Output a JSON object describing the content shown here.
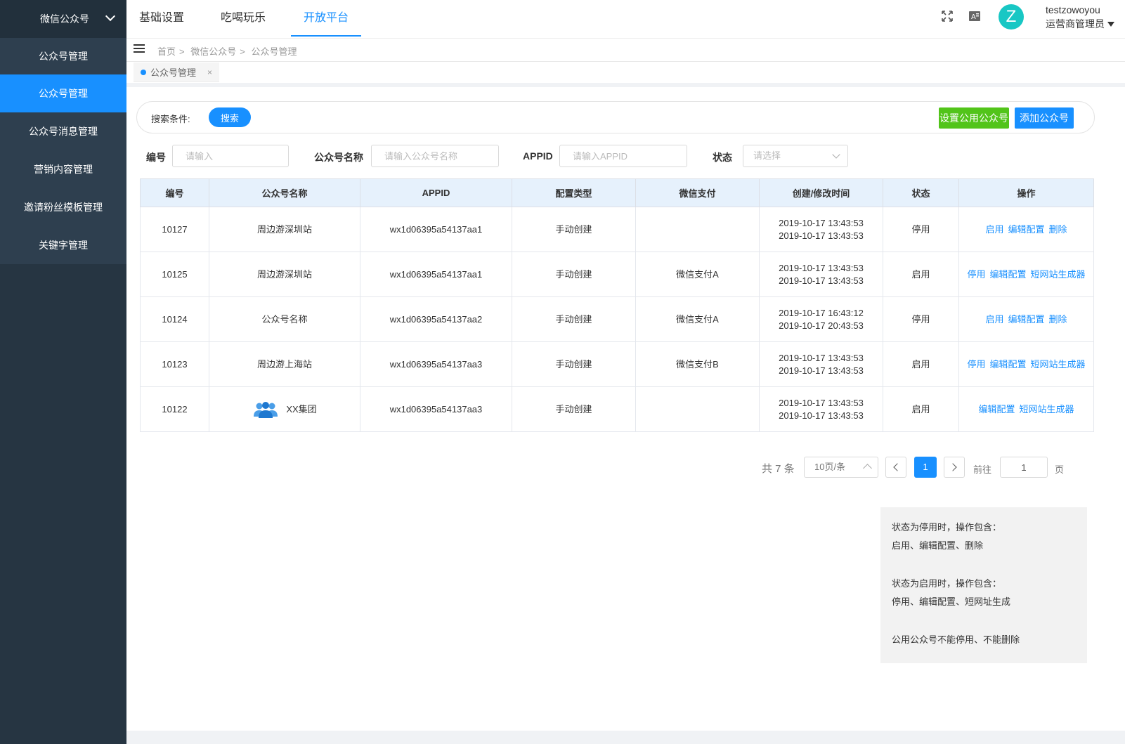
{
  "sidebar": {
    "header": "微信公众号",
    "items": [
      {
        "label": "公众号管理",
        "active": false
      },
      {
        "label": "公众号管理",
        "active": true
      },
      {
        "label": "公众号消息管理",
        "active": false
      },
      {
        "label": "营销内容管理",
        "active": false
      },
      {
        "label": "邀请粉丝模板管理",
        "active": false
      },
      {
        "label": "关键字管理",
        "active": false
      }
    ]
  },
  "header": {
    "tabs": [
      "基础设置",
      "吃喝玩乐",
      "开放平台"
    ],
    "active_tab": "开放平台",
    "avatar_letter": "Z",
    "username": "testzowoyou",
    "role": "运营商管理员",
    "icons": [
      "fullscreen-icon",
      "translate-icon"
    ]
  },
  "breadcrumb": [
    "首页",
    "微信公众号",
    "公众号管理"
  ],
  "tag": {
    "label": "公众号管理",
    "close": "×"
  },
  "search": {
    "label": "搜索条件:",
    "button": "搜索",
    "set_public_button": "设置公用公众号",
    "add_button": "添加公众号"
  },
  "filters": {
    "id_label": "编号",
    "id_placeholder": "请输入",
    "name_label": "公众号名称",
    "name_placeholder": "请输入公众号名称",
    "appid_label": "APPID",
    "appid_placeholder": "请输入APPID",
    "status_label": "状态",
    "status_placeholder": "请选择"
  },
  "table": {
    "columns": [
      "编号",
      "公众号名称",
      "APPID",
      "配置类型",
      "微信支付",
      "创建/修改时间",
      "状态",
      "操作"
    ],
    "rows": [
      {
        "id": "10127",
        "name": "周边游深圳站",
        "appid": "wx1d06395a54137aa1",
        "type": "手动创建",
        "pay": "",
        "created": "2019-10-17 13:43:53",
        "modified": "2019-10-17 13:43:53",
        "status": "停用",
        "disabled": true,
        "ops": [
          "启用",
          "编辑配置",
          "删除"
        ],
        "icon": false
      },
      {
        "id": "10125",
        "name": "周边游深圳站",
        "appid": "wx1d06395a54137aa1",
        "type": "手动创建",
        "pay": "微信支付A",
        "created": "2019-10-17 13:43:53",
        "modified": "2019-10-17 13:43:53",
        "status": "启用",
        "disabled": false,
        "ops": [
          "停用",
          "编辑配置",
          "短网站生成器"
        ],
        "icon": false
      },
      {
        "id": "10124",
        "name": "公众号名称",
        "appid": "wx1d06395a54137aa2",
        "type": "手动创建",
        "pay": "微信支付A",
        "created": "2019-10-17 16:43:12",
        "modified": "2019-10-17 20:43:53",
        "status": "停用",
        "disabled": true,
        "ops": [
          "启用",
          "编辑配置",
          "删除"
        ],
        "icon": false
      },
      {
        "id": "10123",
        "name": "周边游上海站",
        "appid": "wx1d06395a54137aa3",
        "type": "手动创建",
        "pay": "微信支付B",
        "created": "2019-10-17 13:43:53",
        "modified": "2019-10-17 13:43:53",
        "status": "启用",
        "disabled": false,
        "ops": [
          "停用",
          "编辑配置",
          "短网站生成器"
        ],
        "icon": false
      },
      {
        "id": "10122",
        "name": "XX集团",
        "appid": "wx1d06395a54137aa3",
        "type": "手动创建",
        "pay": "",
        "created": "2019-10-17 13:43:53",
        "modified": "2019-10-17 13:43:53",
        "status": "启用",
        "disabled": false,
        "ops": [
          "编辑配置",
          "短网站生成器"
        ],
        "icon": true
      }
    ]
  },
  "pagination": {
    "total": "共 7 条",
    "page_size": "10页/条",
    "current": "1",
    "goto_label": "前往",
    "goto_value": "1",
    "page_label": "页"
  },
  "note": {
    "lines1": [
      "状态为停用时，操作包含：",
      "启用、编辑配置、删除"
    ],
    "lines2": [
      "状态为启用时，操作包含：",
      "停用、编辑配置、短网址生成"
    ],
    "lines3": [
      "公用公众号不能停用、不能删除"
    ]
  },
  "colors": {
    "primary": "#1890ff",
    "green": "#52c41a",
    "danger": "#f5222d",
    "sidebar": "#263542"
  }
}
